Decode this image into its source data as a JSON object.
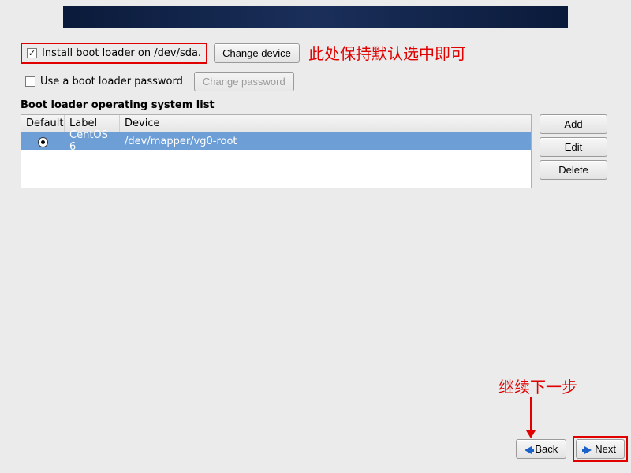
{
  "options": {
    "install_bootloader": {
      "checked": true,
      "label": "Install boot loader on /dev/sda.",
      "change_button": "Change device"
    },
    "use_password": {
      "checked": false,
      "label": "Use a boot loader password",
      "change_button": "Change password"
    }
  },
  "annotations": {
    "keep_default": "此处保持默认选中即可",
    "continue_next": "继续下一步"
  },
  "os_list": {
    "title": "Boot loader operating system list",
    "columns": {
      "default": "Default",
      "label": "Label",
      "device": "Device"
    },
    "rows": [
      {
        "default": true,
        "label": "CentOS 6",
        "device": "/dev/mapper/vg0-root"
      }
    ]
  },
  "side_buttons": {
    "add": "Add",
    "edit": "Edit",
    "delete": "Delete"
  },
  "nav": {
    "back": "Back",
    "next": "Next"
  }
}
